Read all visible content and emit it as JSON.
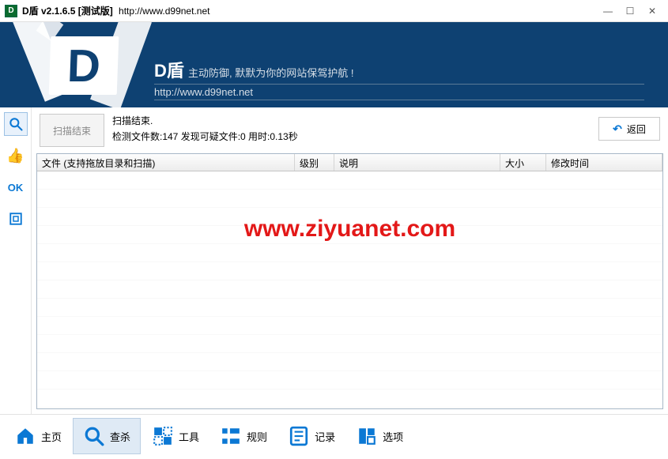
{
  "titlebar": {
    "title": "D盾 v2.1.6.5 [测试版]",
    "url": "http://www.d99net.net"
  },
  "banner": {
    "brand": "D盾",
    "slogan": "主动防御, 默默为你的网站保驾护航 !",
    "url": "http://www.d99net.net"
  },
  "sidebar": {
    "ok_label": "OK"
  },
  "scan": {
    "button": "扫描结束",
    "line1": "扫描结束.",
    "line2": "检测文件数:147 发现可疑文件:0 用时:0.13秒",
    "back": "返回"
  },
  "grid": {
    "columns": {
      "file": "文件 (支持拖放目录和扫描)",
      "level": "级别",
      "desc": "说明",
      "size": "大小",
      "time": "修改时间"
    }
  },
  "watermark": "www.ziyuanet.com",
  "tabs": {
    "home": "主页",
    "scan": "查杀",
    "tools": "工具",
    "rules": "规则",
    "logs": "记录",
    "options": "选项"
  }
}
